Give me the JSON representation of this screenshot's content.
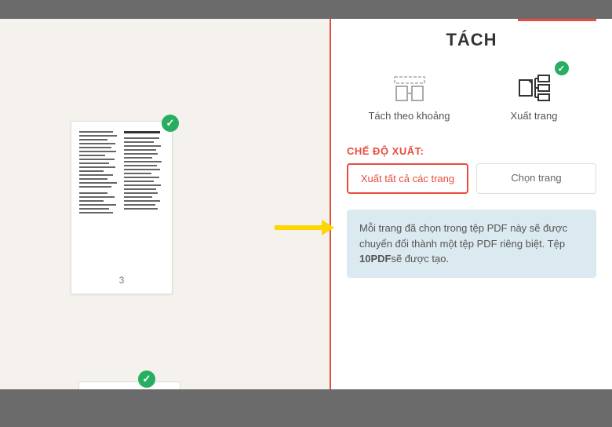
{
  "panel": {
    "title": "TÁCH",
    "modes": [
      {
        "label": "Tách theo khoảng"
      },
      {
        "label": "Xuất trang"
      }
    ],
    "sectionLabel": "CHẾ ĐỘ XUẤT:",
    "exportButtons": [
      {
        "label": "Xuất tất cả các trang"
      },
      {
        "label": "Chọn trang"
      }
    ],
    "info": {
      "prefix": "Mỗi trang đã chọn trong tệp PDF này sẽ được chuyển đổi thành một tệp PDF riêng biệt. Tệp ",
      "bold": "10PDF",
      "suffix": "sẽ được tạo."
    }
  },
  "thumbs": {
    "page3": "3"
  }
}
